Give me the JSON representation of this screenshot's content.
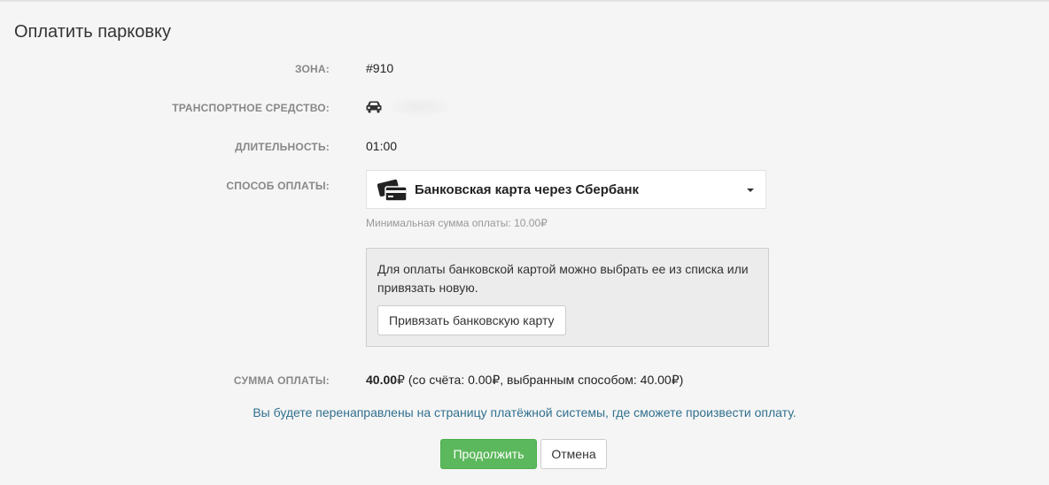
{
  "title": "Оплатить парковку",
  "fields": {
    "zone_label": "ЗОНА:",
    "zone_value": "#910",
    "vehicle_label": "ТРАНСПОРТНОЕ СРЕДСТВО:",
    "duration_label": "ДЛИТЕЛЬНОСТЬ:",
    "duration_value": "01:00",
    "payment_label": "СПОСОБ ОПЛАТЫ:",
    "sum_label": "СУММА ОПЛАТЫ:"
  },
  "payment": {
    "selected": "Банковская карта через Сбербанк",
    "min_hint": "Минимальная сумма оплаты: 10.00₽",
    "info_text": "Для оплаты банковской картой можно выбрать ее из списка или привязать новую.",
    "bind_card_label": "Привязать банковскую карту"
  },
  "sum": {
    "total": "40.00",
    "currency": "₽",
    "details": " (со счёта: 0.00₽, выбранным способом: 40.00₽)"
  },
  "redirect_note": "Вы будете перенаправлены на страницу платёжной системы, где сможете произвести оплату.",
  "buttons": {
    "continue": "Продолжить",
    "cancel": "Отмена"
  },
  "icons": {
    "vehicle": "car-icon",
    "payment": "bank-card-icon",
    "dropdown": "caret-down-icon"
  },
  "colors": {
    "primary_button": "#5cb85c",
    "redirect_text": "#31708f"
  }
}
